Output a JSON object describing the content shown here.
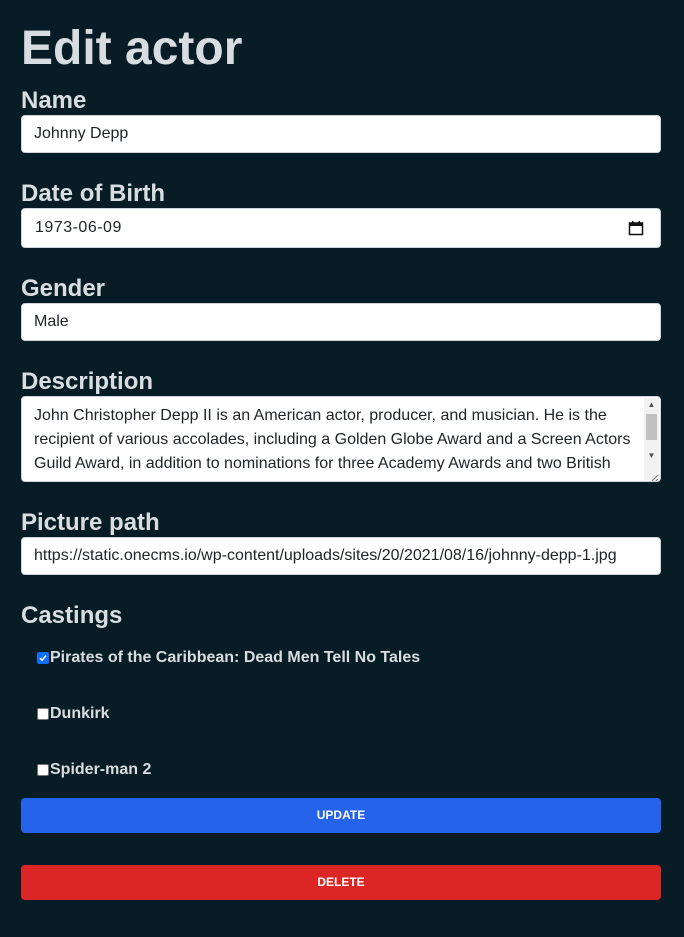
{
  "page": {
    "title": "Edit actor"
  },
  "form": {
    "name": {
      "label": "Name",
      "value": "Johnny Depp"
    },
    "date_of_birth": {
      "label": "Date of Birth",
      "value": "1973-06-09",
      "icon": "calendar-icon"
    },
    "gender": {
      "label": "Gender",
      "value": "Male"
    },
    "description": {
      "label": "Description",
      "value": "John Christopher Depp II is an American actor, producer, and musician. He is the recipient of various accolades, including a Golden Globe Award and a Screen Actors Guild Award, in addition to nominations for three Academy Awards and two British"
    },
    "picture_path": {
      "label": "Picture path",
      "value": "https://static.onecms.io/wp-content/uploads/sites/20/2021/08/16/johnny-depp-1.jpg"
    }
  },
  "castings": {
    "label": "Castings",
    "items": [
      {
        "label": "Pirates of the Caribbean: Dead Men Tell No Tales",
        "checked": true
      },
      {
        "label": "Dunkirk",
        "checked": false
      },
      {
        "label": "Spider-man 2",
        "checked": false
      }
    ]
  },
  "buttons": {
    "update": "UPDATE",
    "delete": "DELETE"
  },
  "colors": {
    "background": "#081c26",
    "update": "#2563eb",
    "delete": "#dc2626",
    "checkbox_checked": "#0b6fff"
  }
}
